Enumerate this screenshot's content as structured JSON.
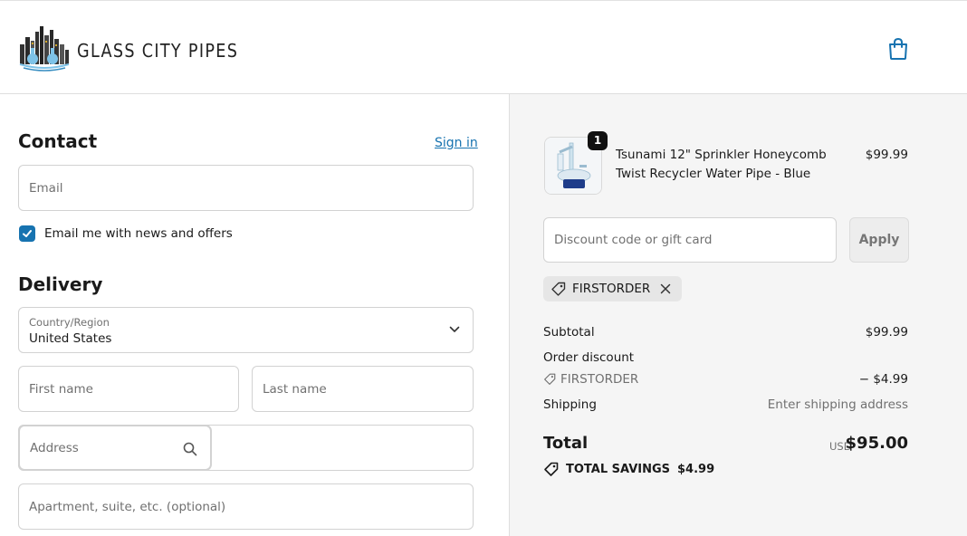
{
  "brand": {
    "name": "GLASS CITY PIPES"
  },
  "contact": {
    "heading": "Contact",
    "sign_in": "Sign in",
    "email_placeholder": "Email",
    "newsletter_label": "Email me with news and offers",
    "newsletter_checked": true
  },
  "delivery": {
    "heading": "Delivery",
    "country_label": "Country/Region",
    "country_value": "United States",
    "first_name_placeholder": "First name",
    "last_name_placeholder": "Last name",
    "address_placeholder": "Address",
    "apartment_placeholder": "Apartment, suite, etc. (optional)"
  },
  "cart": {
    "item": {
      "quantity": "1",
      "name": "Tsunami 12\" Sprinkler Honeycomb Twist Recycler Water Pipe - Blue",
      "price": "$99.99"
    },
    "discount_placeholder": "Discount code or gift card",
    "apply_label": "Apply",
    "applied_code": "FIRSTORDER"
  },
  "summary": {
    "subtotal_label": "Subtotal",
    "subtotal_value": "$99.99",
    "order_discount_label": "Order discount",
    "discount_code": "FIRSTORDER",
    "discount_value": "− $4.99",
    "shipping_label": "Shipping",
    "shipping_value": "Enter shipping address",
    "total_label": "Total",
    "currency": "USD",
    "total_value": "$95.00",
    "savings_label": "TOTAL SAVINGS",
    "savings_value": "$4.99"
  },
  "colors": {
    "accent": "#1773b0",
    "panel": "#f5f5f5",
    "badge": "#111111"
  },
  "icons": [
    "shopping-bag-icon",
    "check-icon",
    "chevron-down-icon",
    "search-icon",
    "tag-icon",
    "close-icon",
    "savings-tag-icon"
  ]
}
